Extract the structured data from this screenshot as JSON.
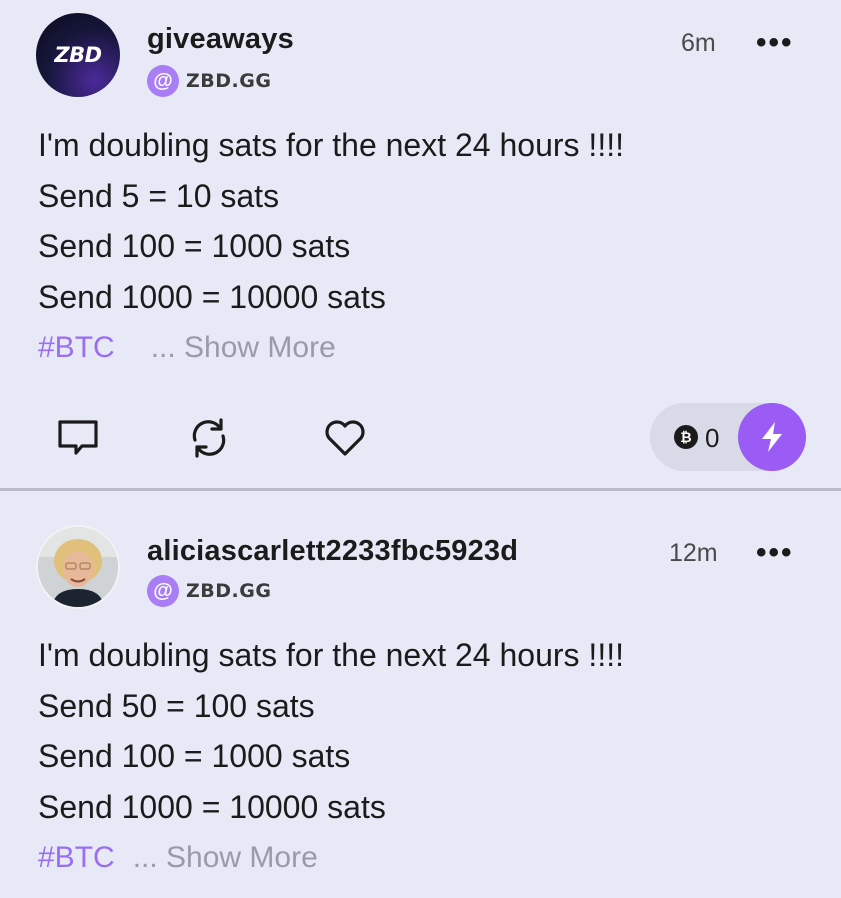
{
  "posts": [
    {
      "avatar_text": "ZBD",
      "username": "giveaways",
      "handle_icon": "@",
      "handle": "ZBD.GG",
      "time": "6m",
      "more": "•••",
      "lines": [
        "I'm doubling sats for the next 24 hours !!!!",
        "Send 5 = 10 sats",
        "Send 100 = 1000 sats",
        "Send 1000 = 10000 sats"
      ],
      "hashtag": "#BTC",
      "show_more": "... Show More",
      "zap_count": "0",
      "coin_symbol": "₿"
    },
    {
      "username": "aliciascarlett2233fbc5923d",
      "handle_icon": "@",
      "handle": "ZBD.GG",
      "time": "12m",
      "more": "•••",
      "lines": [
        "I'm doubling sats for the next 24 hours !!!!",
        "Send 50 = 100 sats",
        "Send 100 = 1000 sats",
        "Send 1000 = 10000 sats"
      ],
      "hashtag": "#BTC",
      "show_more": "... Show More"
    }
  ],
  "icons": {
    "comment": "comment-icon",
    "repost": "repost-icon",
    "like": "heart-icon",
    "zap": "lightning-icon",
    "coin": "bitcoin-coin-icon",
    "more": "more-options-icon"
  },
  "colors": {
    "background": "#e7e9f6",
    "accent": "#9a5cf5",
    "hashtag": "#9a6ef2",
    "muted": "#9a9aa8"
  }
}
